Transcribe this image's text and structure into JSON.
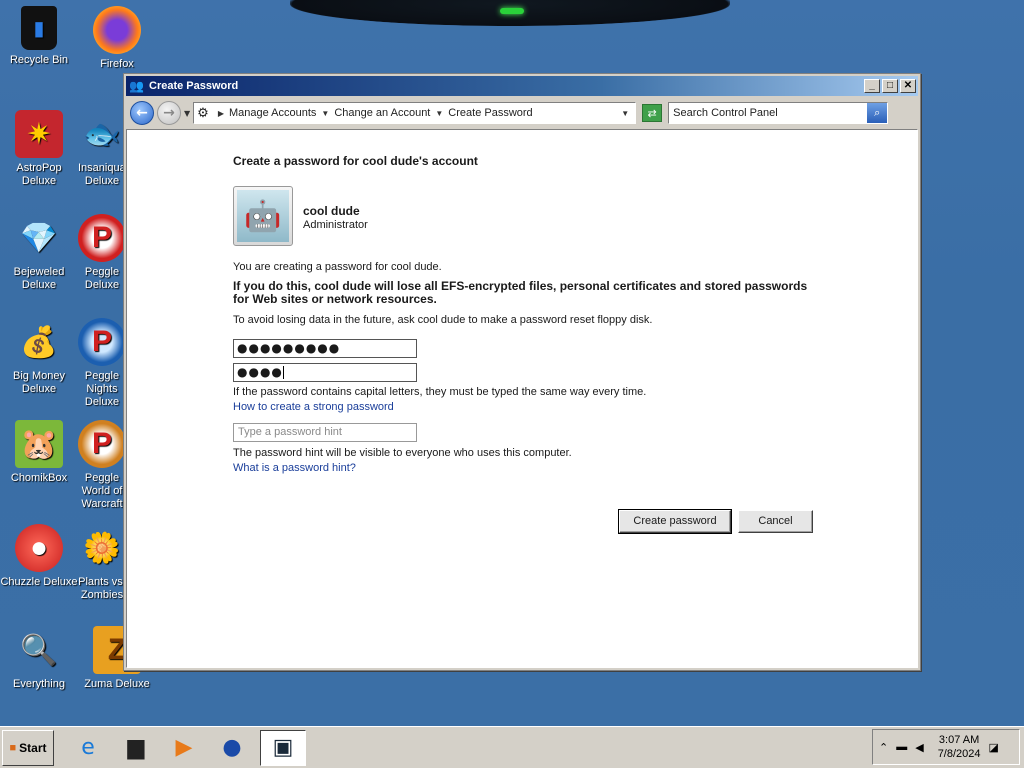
{
  "desktop": {
    "icons": [
      {
        "label": "Recycle Bin",
        "icon": "recycle-bin-icon",
        "glyph": "🗑"
      },
      {
        "label": "Firefox",
        "icon": "firefox-icon",
        "glyph": "🦊"
      },
      {
        "label": "AstroPop Deluxe",
        "icon": "astropop-icon",
        "glyph": "✷"
      },
      {
        "label": "Insaniquarium Deluxe",
        "icon": "insaniquarium-icon",
        "glyph": "🐟"
      },
      {
        "label": "Bejeweled Deluxe",
        "icon": "bejeweled-icon",
        "glyph": "💎"
      },
      {
        "label": "Peggle Deluxe",
        "icon": "peggle-icon",
        "glyph": "P"
      },
      {
        "label": "Big Money Deluxe",
        "icon": "big-money-icon",
        "glyph": "💰"
      },
      {
        "label": "Peggle Nights Deluxe",
        "icon": "peggle-nights-icon",
        "glyph": "P"
      },
      {
        "label": "ChomikBox",
        "icon": "chomikbox-icon",
        "glyph": "🐹"
      },
      {
        "label": "Peggle World of Warcraft",
        "icon": "peggle-wow-icon",
        "glyph": "P"
      },
      {
        "label": "Chuzzle Deluxe",
        "icon": "chuzzle-icon",
        "glyph": "●"
      },
      {
        "label": "Plants vs. Zombies",
        "icon": "pvz-icon",
        "glyph": "🌼"
      },
      {
        "label": "Everything",
        "icon": "everything-search-icon",
        "glyph": "🔍"
      },
      {
        "label": "Zuma Deluxe",
        "icon": "zuma-icon",
        "glyph": "Z"
      }
    ]
  },
  "window": {
    "title": "Create Password",
    "minimize": "_",
    "maximize": "□",
    "close": "✕"
  },
  "nav": {
    "breadcrumbs": [
      "Manage Accounts",
      "Change an Account",
      "Create Password"
    ],
    "search_placeholder": "Search Control Panel"
  },
  "content": {
    "heading": "Create a password for cool dude's account",
    "account_name": "cool dude",
    "account_role": "Administrator",
    "intro": "You are creating a password for cool dude.",
    "warning": "If you do this, cool dude will lose all EFS-encrypted files, personal certificates and stored passwords for Web sites or network resources.",
    "advice": "To avoid losing data in the future, ask cool dude to make a password reset floppy disk.",
    "password_value": "●●●●●●●●●",
    "confirm_value": "●●●●",
    "caps_note": "If the password contains capital letters, they must be typed the same way every time.",
    "strong_link": "How to create a strong password",
    "hint_placeholder": "Type a password hint",
    "hint_note": "The password hint will be visible to everyone who uses this computer.",
    "hint_link": "What is a password hint?",
    "create_button": "Create password",
    "cancel_button": "Cancel"
  },
  "taskbar": {
    "start_label": "Start",
    "clock_time": "3:07 AM",
    "clock_date": "7/8/2024"
  }
}
